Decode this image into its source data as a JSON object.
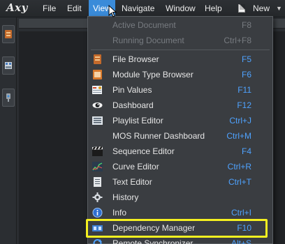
{
  "app": {
    "logo": "Axy"
  },
  "menubar": {
    "items": [
      {
        "label": "File"
      },
      {
        "label": "Edit"
      },
      {
        "label": "View"
      },
      {
        "label": "Navigate"
      },
      {
        "label": "Window"
      },
      {
        "label": "Help"
      }
    ],
    "new_label": "New",
    "new_caret": "▼"
  },
  "view_menu": {
    "items": [
      {
        "label": "Active Document",
        "shortcut": "F8",
        "icon": "none",
        "enabled": false
      },
      {
        "label": "Running Document",
        "shortcut": "Ctrl+F8",
        "icon": "none",
        "enabled": false
      },
      {
        "label": "File Browser",
        "shortcut": "F5",
        "icon": "file-browser-icon",
        "enabled": true
      },
      {
        "label": "Module Type Browser",
        "shortcut": "F6",
        "icon": "module-type-browser-icon",
        "enabled": true
      },
      {
        "label": "Pin Values",
        "shortcut": "F11",
        "icon": "pin-values-icon",
        "enabled": true
      },
      {
        "label": "Dashboard",
        "shortcut": "F12",
        "icon": "eye-icon",
        "enabled": true
      },
      {
        "label": "Playlist Editor",
        "shortcut": "Ctrl+J",
        "icon": "playlist-icon",
        "enabled": true
      },
      {
        "label": "MOS Runner Dashboard",
        "shortcut": "Ctrl+M",
        "icon": "none",
        "enabled": true
      },
      {
        "label": "Sequence Editor",
        "shortcut": "F4",
        "icon": "clapperboard-icon",
        "enabled": true
      },
      {
        "label": "Curve Editor",
        "shortcut": "Ctrl+R",
        "icon": "curve-icon",
        "enabled": true
      },
      {
        "label": "Text Editor",
        "shortcut": "Ctrl+T",
        "icon": "text-document-icon",
        "enabled": true
      },
      {
        "label": "History",
        "shortcut": "",
        "icon": "gear-icon",
        "enabled": true
      },
      {
        "label": "Info",
        "shortcut": "Ctrl+I",
        "icon": "info-icon",
        "enabled": true
      },
      {
        "label": "Dependency Manager",
        "shortcut": "F10",
        "icon": "dependency-icon",
        "enabled": true
      },
      {
        "label": "Remote Synchronizer",
        "shortcut": "Alt+S",
        "icon": "sync-icon",
        "enabled": true
      }
    ]
  },
  "colors": {
    "accent": "#3a8bd9",
    "shortcut": "#4fa3ff",
    "highlight": "#f4f020"
  }
}
